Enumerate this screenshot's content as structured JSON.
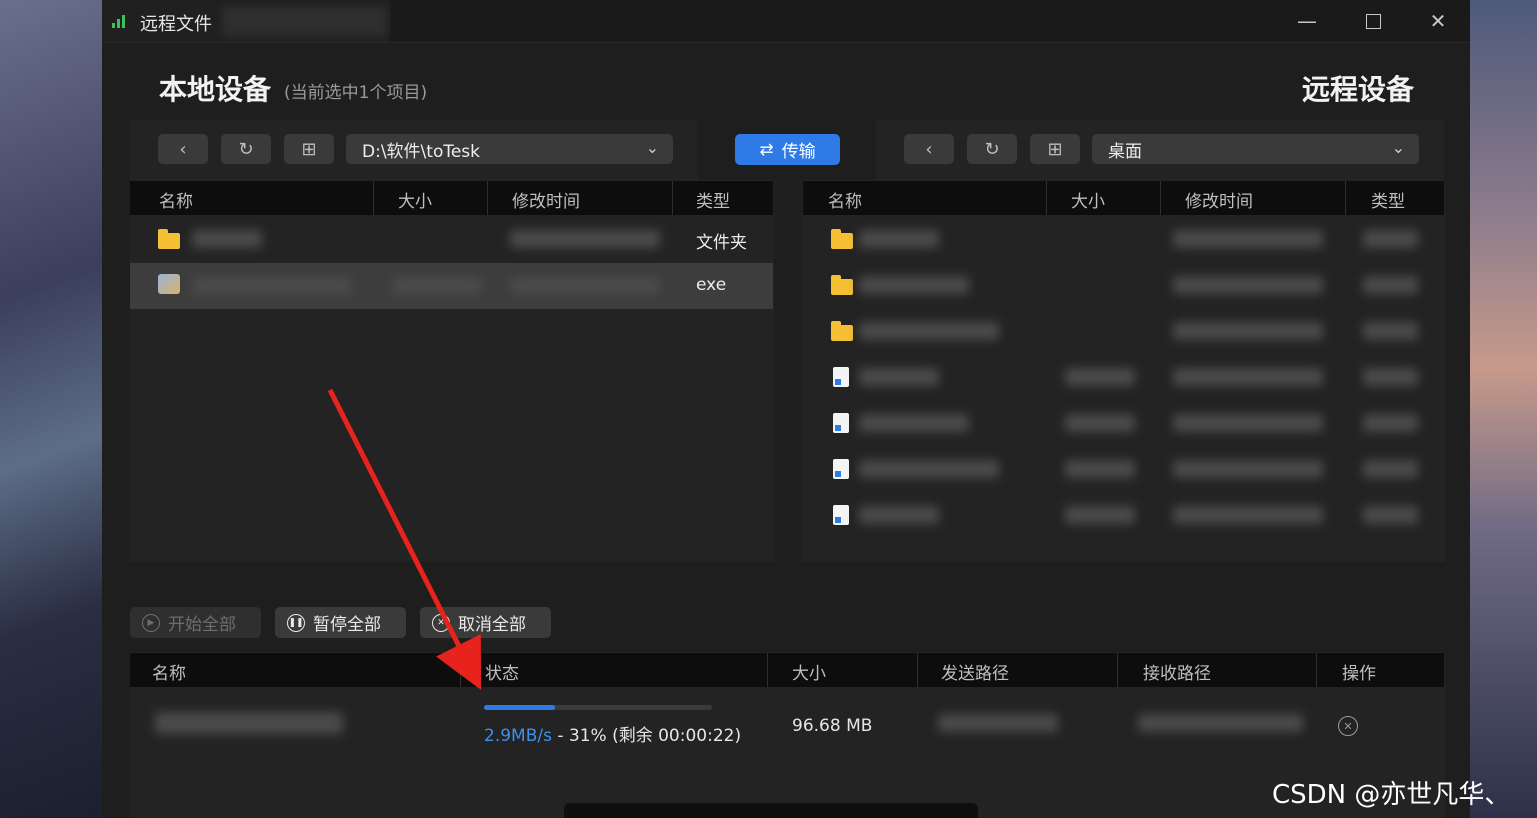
{
  "window": {
    "title": "远程文件"
  },
  "local": {
    "title": "本地设备",
    "subtitle": "(当前选中1个项目)",
    "path": "D:\\软件\\toTesk",
    "columns": [
      "名称",
      "大小",
      "修改时间",
      "类型"
    ],
    "rows": [
      {
        "type": "文件夹",
        "icon": "folder-icon"
      },
      {
        "type": "exe",
        "icon": "exe-icon",
        "selected": true
      }
    ]
  },
  "transfer_button": "传输",
  "remote": {
    "title": "远程设备",
    "path": "桌面",
    "columns": [
      "名称",
      "大小",
      "修改时间",
      "类型"
    ],
    "rows": [
      {
        "icon": "folder-icon"
      },
      {
        "icon": "folder-icon"
      },
      {
        "icon": "folder-icon"
      },
      {
        "icon": "file-icon"
      },
      {
        "icon": "file-icon"
      },
      {
        "icon": "file-icon"
      },
      {
        "icon": "file-icon"
      }
    ]
  },
  "queue": {
    "buttons": {
      "start_all": "开始全部",
      "pause_all": "暂停全部",
      "cancel_all": "取消全部"
    },
    "columns": [
      "名称",
      "状态",
      "大小",
      "发送路径",
      "接收路径",
      "操作"
    ],
    "item": {
      "speed": "2.9MB/s",
      "progress_text": " - 31% (剩余 00:00:22)",
      "progress_fraction": 0.31,
      "size": "96.68 MB"
    }
  },
  "watermark": "CSDN @亦世凡华、",
  "colors": {
    "accent": "#2e7ae6",
    "annotation_arrow": "#e8231e"
  }
}
